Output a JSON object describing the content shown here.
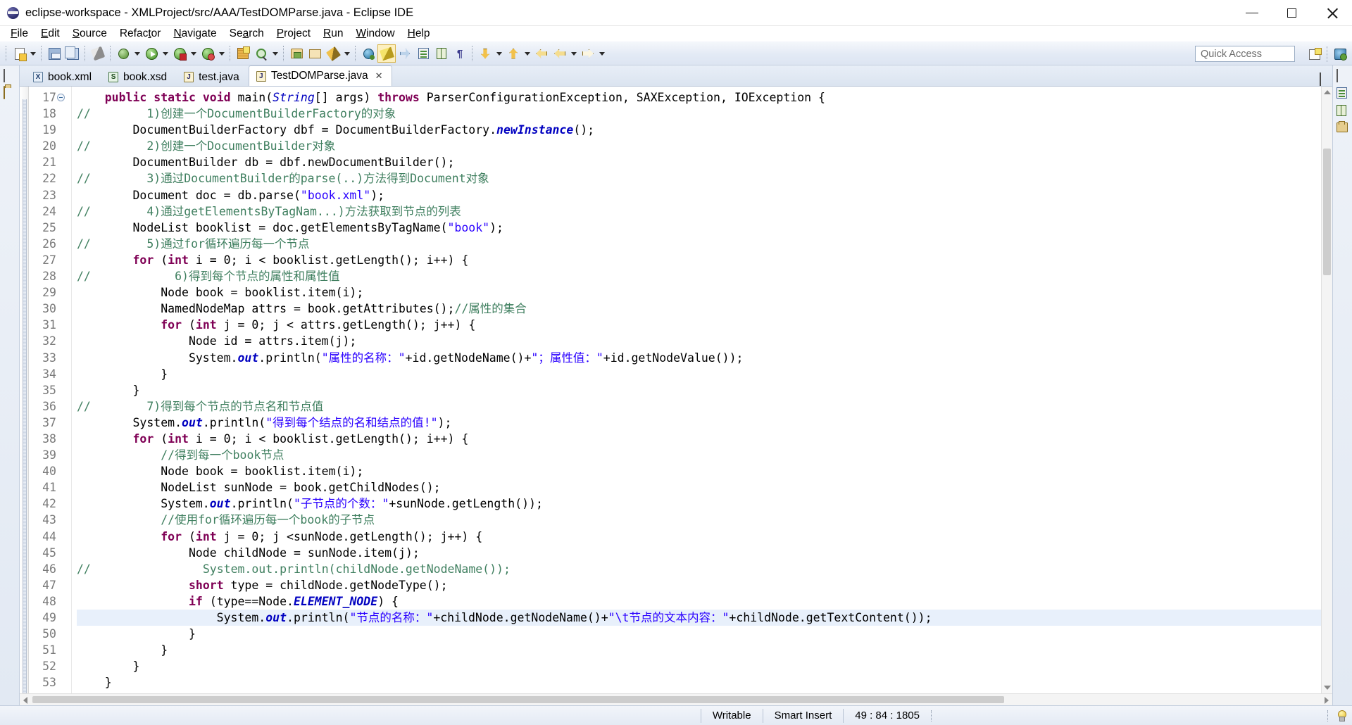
{
  "window": {
    "title": "eclipse-workspace - XMLProject/src/AAA/TestDOMParse.java - Eclipse IDE",
    "app_icon": "eclipse-icon",
    "minimize_label": "Minimize",
    "maximize_label": "Maximize",
    "close_label": "Close"
  },
  "menubar": {
    "items": [
      {
        "label": "File"
      },
      {
        "label": "Edit"
      },
      {
        "label": "Source"
      },
      {
        "label": "Refactor"
      },
      {
        "label": "Navigate"
      },
      {
        "label": "Search"
      },
      {
        "label": "Project"
      },
      {
        "label": "Run"
      },
      {
        "label": "Window"
      },
      {
        "label": "Help"
      }
    ]
  },
  "toolbar": {
    "quick_access_placeholder": "Quick Access",
    "quick_access_value": "",
    "icons": [
      "new-wizard-icon",
      "save-icon",
      "save-all-icon",
      "quick-fix-icon",
      "debug-icon",
      "run-icon",
      "run-last-tool-icon",
      "coverage-icon",
      "new-java-package-icon",
      "external-tools-icon",
      "open-type-icon",
      "open-task-icon",
      "search-icon",
      "link-editor-icon",
      "toggle-mark-occurrences-icon",
      "skip-all-breakpoints-icon",
      "next-annotation-icon",
      "previous-annotation-icon",
      "pilcrow-icon",
      "back-icon",
      "forward-icon"
    ],
    "right_icons": [
      "open-perspective-icon",
      "java-perspective-icon"
    ]
  },
  "editor": {
    "tabs": [
      {
        "label": "book.xml",
        "icon": "xml-file-icon",
        "kind": "X",
        "active": false,
        "closable": false
      },
      {
        "label": "book.xsd",
        "icon": "xsd-file-icon",
        "kind": "S",
        "active": false,
        "closable": false
      },
      {
        "label": "test.java",
        "icon": "java-file-icon",
        "kind": "J",
        "active": false,
        "closable": false
      },
      {
        "label": "TestDOMParse.java",
        "icon": "java-file-icon",
        "kind": "J",
        "active": true,
        "closable": true
      }
    ],
    "close_glyph": "✕",
    "minimize_label": "Minimize",
    "maximize_label": "Maximize",
    "first_visible_line": 17,
    "highlighted_line": 49,
    "lines": [
      {
        "n": 17,
        "fold": true,
        "html": "    <span class=\"kw\">public static void</span> main(<span class=\"fld\">String</span>[] args) <span class=\"kw\">throws</span> ParserConfigurationException, SAXException, IOException {"
      },
      {
        "n": 18,
        "fold": false,
        "html": "<span class=\"cmt\">//</span>        <span class=\"cmt\">1)创建一个DocumentBuilderFactory的对象</span>"
      },
      {
        "n": 19,
        "fold": false,
        "html": "        DocumentBuilderFactory dbf = DocumentBuilderFactory.<span class=\"stat\">newInstance</span>();"
      },
      {
        "n": 20,
        "fold": false,
        "html": "<span class=\"cmt\">//</span>        <span class=\"cmt\">2)创建一个DocumentBuilder对象</span>"
      },
      {
        "n": 21,
        "fold": false,
        "html": "        DocumentBuilder db = dbf.newDocumentBuilder();"
      },
      {
        "n": 22,
        "fold": false,
        "html": "<span class=\"cmt\">//</span>        <span class=\"cmt\">3)通过DocumentBuilder的parse(..)方法得到Document对象</span>"
      },
      {
        "n": 23,
        "fold": false,
        "html": "        Document doc = db.parse(<span class=\"str\">\"book.xml\"</span>);"
      },
      {
        "n": 24,
        "fold": false,
        "html": "<span class=\"cmt\">//</span>        <span class=\"cmt\">4)通过getElementsByTagNam...)方法获取到节点的列表</span>"
      },
      {
        "n": 25,
        "fold": false,
        "html": "        NodeList booklist = doc.getElementsByTagName(<span class=\"str\">\"book\"</span>);"
      },
      {
        "n": 26,
        "fold": false,
        "html": "<span class=\"cmt\">//</span>        <span class=\"cmt\">5)通过for循环遍历每一个节点</span>"
      },
      {
        "n": 27,
        "fold": false,
        "html": "        <span class=\"kw\">for</span> (<span class=\"kw\">int</span> i = 0; i &lt; booklist.getLength(); i++) {"
      },
      {
        "n": 28,
        "fold": false,
        "html": "<span class=\"cmt\">//</span>            <span class=\"cmt\">6)得到每个节点的属性和属性值</span>"
      },
      {
        "n": 29,
        "fold": false,
        "html": "            Node book = booklist.item(i);"
      },
      {
        "n": 30,
        "fold": false,
        "html": "            NamedNodeMap attrs = book.getAttributes();<span class=\"cmt\">//属性的集合</span>"
      },
      {
        "n": 31,
        "fold": false,
        "html": "            <span class=\"kw\">for</span> (<span class=\"kw\">int</span> j = 0; j &lt; attrs.getLength(); j++) {"
      },
      {
        "n": 32,
        "fold": false,
        "html": "                Node id = attrs.item(j);"
      },
      {
        "n": 33,
        "fold": false,
        "html": "                System.<span class=\"stat\">out</span>.println(<span class=\"str\">\"属性的名称：\"</span>+id.getNodeName()+<span class=\"str\">\"；属性值：\"</span>+id.getNodeValue());"
      },
      {
        "n": 34,
        "fold": false,
        "html": "            }"
      },
      {
        "n": 35,
        "fold": false,
        "html": "        }"
      },
      {
        "n": 36,
        "fold": false,
        "html": "<span class=\"cmt\">//</span>        <span class=\"cmt\">7)得到每个节点的节点名和节点值</span>"
      },
      {
        "n": 37,
        "fold": false,
        "html": "        System.<span class=\"stat\">out</span>.println(<span class=\"str\">\"得到每个结点的名和结点的值!\"</span>);"
      },
      {
        "n": 38,
        "fold": false,
        "html": "        <span class=\"kw\">for</span> (<span class=\"kw\">int</span> i = 0; i &lt; booklist.getLength(); i++) {"
      },
      {
        "n": 39,
        "fold": false,
        "html": "            <span class=\"cmt\">//得到每一个book节点</span>"
      },
      {
        "n": 40,
        "fold": false,
        "html": "            Node book = booklist.item(i);"
      },
      {
        "n": 41,
        "fold": false,
        "html": "            NodeList sunNode = book.getChildNodes();"
      },
      {
        "n": 42,
        "fold": false,
        "html": "            System.<span class=\"stat\">out</span>.println(<span class=\"str\">\"子节点的个数：\"</span>+sunNode.getLength());"
      },
      {
        "n": 43,
        "fold": false,
        "html": "            <span class=\"cmt\">//使用for循环遍历每一个book的子节点</span>"
      },
      {
        "n": 44,
        "fold": false,
        "html": "            <span class=\"kw\">for</span> (<span class=\"kw\">int</span> j = 0; j &lt;sunNode.getLength(); j++) {"
      },
      {
        "n": 45,
        "fold": false,
        "html": "                Node childNode = sunNode.item(j);"
      },
      {
        "n": 46,
        "fold": false,
        "html": "<span class=\"cmt\">//</span>                <span class=\"cmt\">System.out.println(childNode.getNodeName());</span>"
      },
      {
        "n": 47,
        "fold": false,
        "html": "                <span class=\"kw\">short</span> type = childNode.getNodeType();"
      },
      {
        "n": 48,
        "fold": false,
        "html": "                <span class=\"kw\">if</span> (type==Node.<span class=\"stat\">ELEMENT_NODE</span>) {"
      },
      {
        "n": 49,
        "fold": false,
        "html": "                    System.<span class=\"stat\">out</span>.println(<span class=\"str\">\"节点的名称：\"</span>+childNode.getNodeName()+<span class=\"str\">\"\\t节点的文本内容：\"</span>+childNode.getTextContent());"
      },
      {
        "n": 50,
        "fold": false,
        "html": "                }"
      },
      {
        "n": 51,
        "fold": false,
        "html": "            }"
      },
      {
        "n": 52,
        "fold": false,
        "html": "        }"
      },
      {
        "n": 53,
        "fold": false,
        "html": "    }"
      }
    ]
  },
  "left_strip": {
    "icons": [
      "restore-view-icon",
      "package-explorer-icon"
    ]
  },
  "right_strip": {
    "icons": [
      "restore-view-icon",
      "outline-view-icon",
      "task-list-icon",
      "templates-view-icon"
    ]
  },
  "statusbar": {
    "writable": "Writable",
    "insert_mode": "Smart Insert",
    "position": "49 : 84 : 1805",
    "bulb_icon": "tip-bulb-icon"
  },
  "colors": {
    "keyword": "#7f0055",
    "string": "#2a00ff",
    "comment": "#3f7f5f",
    "static_field": "#0000c0",
    "highlight_line": "#e8f0fb",
    "toolbar_bg": "#e3eaf5",
    "tab_active_bg": "#ffffff"
  }
}
